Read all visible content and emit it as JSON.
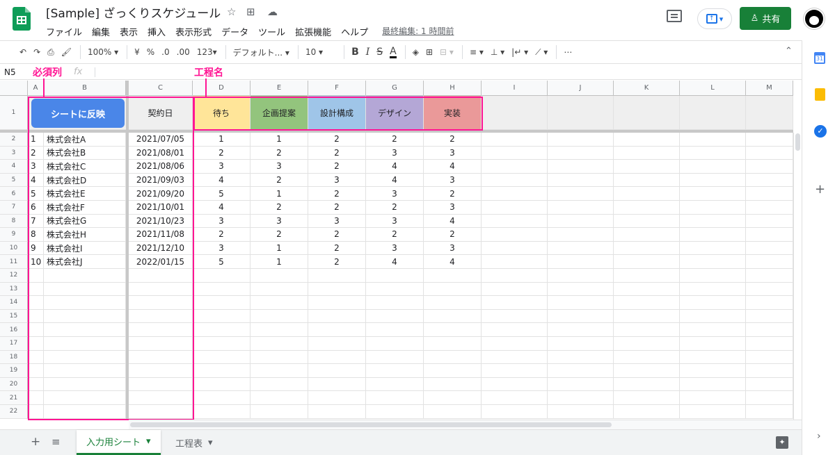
{
  "doc": {
    "title": "[Sample] ざっくりスケジュール",
    "last_edit": "最終編集: 1 時間前"
  },
  "menu": [
    "ファイル",
    "編集",
    "表示",
    "挿入",
    "表示形式",
    "データ",
    "ツール",
    "拡張機能",
    "ヘルプ"
  ],
  "share": {
    "label": "共有"
  },
  "toolbar": {
    "zoom": "100%",
    "currency": "¥",
    "percent": "%",
    "dec_dec": ".0",
    "dec_inc": ".00",
    "format_123": "123",
    "font": "デフォルト...",
    "font_size": "10",
    "bold": "B",
    "italic": "I",
    "strike": "S",
    "text_color": "A"
  },
  "namebox": "N5",
  "fx": "fx",
  "annotations": {
    "required": "必須列",
    "process": "工程名"
  },
  "columns": [
    "A",
    "B",
    "C",
    "D",
    "E",
    "F",
    "G",
    "H",
    "I",
    "J",
    "K",
    "L",
    "M"
  ],
  "header": {
    "button": "シートに反映",
    "contract": "契約日",
    "processes": [
      {
        "label": "待ち",
        "color": "#ffe599"
      },
      {
        "label": "企画提案",
        "color": "#93c47d"
      },
      {
        "label": "設計構成",
        "color": "#9fc5e8"
      },
      {
        "label": "デザイン",
        "color": "#b4a7d6"
      },
      {
        "label": "実装",
        "color": "#ea9999"
      }
    ]
  },
  "rows": [
    {
      "a": "1",
      "b": "株式会社A",
      "c": "2021/07/05",
      "v": [
        "1",
        "1",
        "2",
        "2",
        "2"
      ]
    },
    {
      "a": "2",
      "b": "株式会社B",
      "c": "2021/08/01",
      "v": [
        "2",
        "2",
        "2",
        "3",
        "3"
      ]
    },
    {
      "a": "3",
      "b": "株式会社C",
      "c": "2021/08/06",
      "v": [
        "3",
        "3",
        "2",
        "4",
        "4"
      ]
    },
    {
      "a": "4",
      "b": "株式会社D",
      "c": "2021/09/03",
      "v": [
        "4",
        "2",
        "3",
        "4",
        "3"
      ]
    },
    {
      "a": "5",
      "b": "株式会社E",
      "c": "2021/09/20",
      "v": [
        "5",
        "1",
        "2",
        "3",
        "2"
      ]
    },
    {
      "a": "6",
      "b": "株式会社F",
      "c": "2021/10/01",
      "v": [
        "4",
        "2",
        "2",
        "2",
        "3"
      ]
    },
    {
      "a": "7",
      "b": "株式会社G",
      "c": "2021/10/23",
      "v": [
        "3",
        "3",
        "3",
        "3",
        "4"
      ]
    },
    {
      "a": "8",
      "b": "株式会社H",
      "c": "2021/11/08",
      "v": [
        "2",
        "2",
        "2",
        "2",
        "2"
      ]
    },
    {
      "a": "9",
      "b": "株式会社I",
      "c": "2021/12/10",
      "v": [
        "3",
        "1",
        "2",
        "3",
        "3"
      ]
    },
    {
      "a": "10",
      "b": "株式会社J",
      "c": "2022/01/15",
      "v": [
        "5",
        "1",
        "2",
        "4",
        "4"
      ]
    }
  ],
  "row_numbers": [
    "1",
    "2",
    "3",
    "4",
    "5",
    "6",
    "7",
    "8",
    "9",
    "10",
    "11",
    "12",
    "13",
    "14",
    "15",
    "16",
    "17",
    "18",
    "19",
    "20",
    "21",
    "22"
  ],
  "sheets": [
    {
      "label": "入力用シート",
      "active": true
    },
    {
      "label": "工程表",
      "active": false
    }
  ]
}
